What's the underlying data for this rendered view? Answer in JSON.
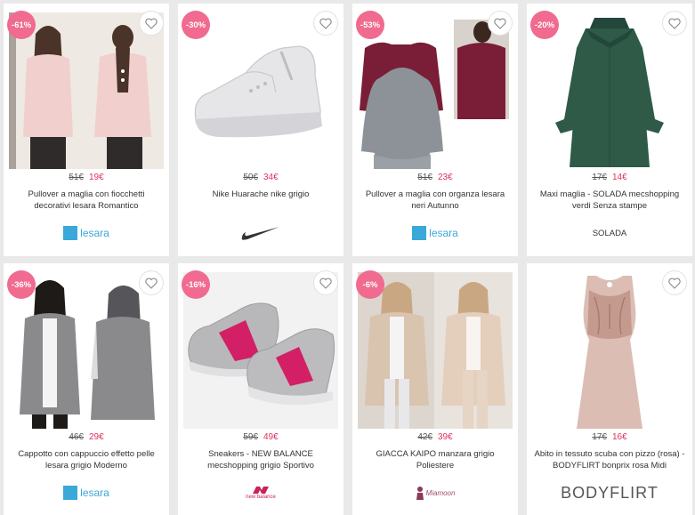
{
  "products": [
    {
      "discount": "-61%",
      "old_price": "51€",
      "new_price": "19€",
      "title": "Pullover a maglia con fiocchetti decorativi lesara Romantico",
      "brand": "lesara",
      "brand_type": "lesara",
      "image_color": "#f1d4d3"
    },
    {
      "discount": "-30%",
      "old_price": "50€",
      "new_price": "34€",
      "title": "Nike Huarache nike grigio",
      "brand": "",
      "brand_type": "swoosh",
      "image_color": "#e6e6e6"
    },
    {
      "discount": "-53%",
      "old_price": "51€",
      "new_price": "23€",
      "title": "Pullover a maglia con organza lesara neri Autunno",
      "brand": "lesara",
      "brand_type": "lesara",
      "image_color": "#7a1d36"
    },
    {
      "discount": "-20%",
      "old_price": "17€",
      "new_price": "14€",
      "title": "Maxi maglia - SOLADA mecshopping verdi Senza stampe",
      "brand": "SOLADA",
      "brand_type": "text",
      "image_color": "#2e5a47"
    },
    {
      "discount": "-36%",
      "old_price": "46€",
      "new_price": "29€",
      "title": "Cappotto con cappuccio effetto pelle lesara grigio Moderno",
      "brand": "lesara",
      "brand_type": "lesara",
      "image_color": "#8b8b8d"
    },
    {
      "discount": "-16%",
      "old_price": "59€",
      "new_price": "49€",
      "title": "Sneakers - NEW BALANCE mecshopping grigio Sportivo",
      "brand": "new balance",
      "brand_type": "nb",
      "image_color": "#b5b5b7"
    },
    {
      "discount": "-6%",
      "old_price": "42€",
      "new_price": "39€",
      "title": "GIACCA KAIPO manzara grigio Poliestere",
      "brand": "Miamoon",
      "brand_type": "script",
      "image_color": "#d9c4b0"
    },
    {
      "discount": "",
      "old_price": "17€",
      "new_price": "16€",
      "title": "Abito in tessuto scuba con pizzo (rosa) - BODYFLIRT bonprix rosa Midi",
      "brand": "BODYFLIRT",
      "brand_type": "big",
      "image_color": "#d9b8ae"
    }
  ]
}
